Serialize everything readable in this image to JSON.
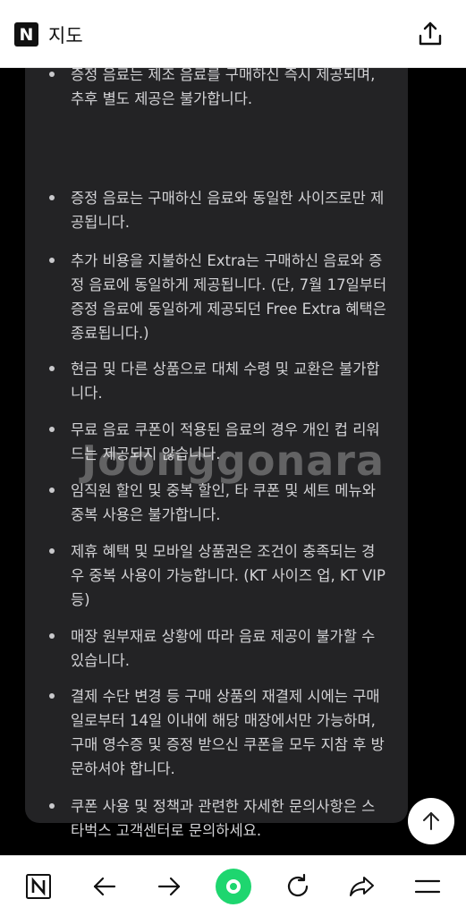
{
  "app": {
    "title": "지도",
    "logo": "N"
  },
  "notices": [
    {
      "text": "증정 음료는 제조 음료를 구매하신 즉시 제공되며,\n추후 별도 제공은 불가합니다."
    },
    {
      "text": "증정 음료는 구매하신 음료와 동일한 사이즈로만 제\n공됩니다."
    },
    {
      "text": "추가 비용을 지불하신 Extra는 구매하신 음료와 증\n정 음료에 동일하게 제공됩니다. (단, 7월 17일부터\n증정 음료에 동일하게 제공되던 Free Extra 혜택은\n종료됩니다.)"
    },
    {
      "text": "현금 및 다른 상품으로 대체 수령 및 교환은 불가합\n니다."
    },
    {
      "text": "무료 음료 쿠폰이 적용된 음료의 경우 개인 컵 리워\n드는 제공되지 않습니다."
    },
    {
      "text": "임직원 할인 및 중복 할인, 타 쿠폰 및 세트 메뉴와\n중복 사용은 불가합니다."
    },
    {
      "text": "제휴 혜택 및 모바일 상품권은 조건이 충족되는 경\n우 중복 사용이 가능합니다. (KT 사이즈 업, KT VIP\n등)"
    },
    {
      "text": "매장 원부재료 상황에 따라 음료 제공이 불가할 수\n있습니다."
    },
    {
      "text": "결제 수단 변경 등 구매 상품의 재결제 시에는 구매\n일로부터 14일 이내에 해당 매장에서만 가능하며,\n구매 영수증 및 증정 받으신 쿠폰을 모두 지참 후 방\n문하셔야 합니다."
    },
    {
      "text": "쿠폰 사용 및 정책과 관련한 자세한 문의사항은 스\n타벅스 고객센터로 문의하세요."
    }
  ],
  "watermark": "Joonggonara",
  "colors": {
    "accent": "#1ed66f",
    "card": "#232325",
    "background": "#000000"
  },
  "icons": {
    "share": "share-icon",
    "scroll_top": "arrow-up-icon",
    "home": "naver-home-icon",
    "back": "arrow-left-icon",
    "forward": "arrow-right-icon",
    "green": "green-dot-icon",
    "reload": "reload-icon",
    "share_nav": "share-forward-icon",
    "menu": "menu-icon"
  }
}
